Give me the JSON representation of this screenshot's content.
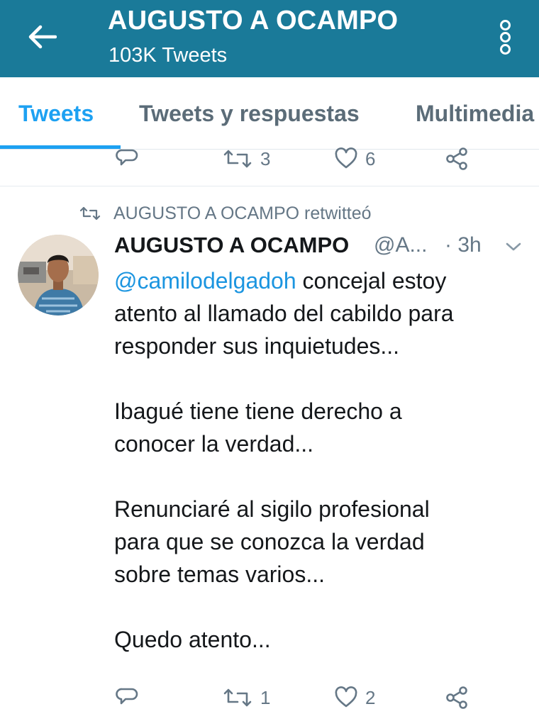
{
  "header": {
    "title": "AUGUSTO A OCAMPO",
    "subtitle": "103K Tweets",
    "back_icon": "arrow-left-icon",
    "menu_icon": "more-vertical-icon",
    "background_color": "#1a7a99"
  },
  "tabs": [
    {
      "label": "Tweets",
      "active": true
    },
    {
      "label": "Tweets y respuestas",
      "active": false
    },
    {
      "label": "Multimedia",
      "active": false
    }
  ],
  "previous_tweet_actions": {
    "retweets": "3",
    "likes": "6"
  },
  "tweet": {
    "retweet_context": "AUGUSTO A OCAMPO retwitteó",
    "author_name": "AUGUSTO A OCAMPO",
    "author_handle": "@A...",
    "time": "· 3h",
    "mention": "@camilodelgadoh",
    "line1_rest": " concejal estoy",
    "line2": "atento al llamado del cabildo para",
    "line3": "responder sus inquietudes...",
    "line4": "Ibagué tiene tiene derecho a",
    "line5": "conocer la verdad...",
    "line6": "Renunciaré al sigilo profesional",
    "line7": "para que se conozca la verdad",
    "line8": "sobre temas varios...",
    "line9": "Quedo atento...",
    "actions": {
      "retweets": "1",
      "likes": "2"
    }
  },
  "colors": {
    "accent": "#1da1f2",
    "mention": "#1b95e0",
    "muted": "#657786"
  }
}
